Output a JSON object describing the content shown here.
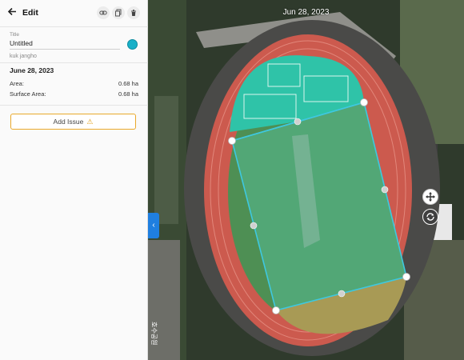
{
  "header": {
    "title": "Edit",
    "back_icon": "arrow-left-icon",
    "actions": [
      "link-icon",
      "copy-icon",
      "trash-icon"
    ]
  },
  "form": {
    "title_label": "Title",
    "title_value": "Untitled",
    "color": "#18b0c8",
    "author": "kuk jangho",
    "date": "June 28, 2023",
    "stats": [
      {
        "label": "Area:",
        "value": "0.68 ha"
      },
      {
        "label": "Surface Area:",
        "value": "0.68 ha"
      }
    ],
    "add_issue_label": "Add Issue",
    "add_issue_icon": "warning-icon"
  },
  "map": {
    "date": "Jun 28, 2023",
    "side_label": "호수공원",
    "controls": [
      "move-icon",
      "rotate-icon"
    ],
    "polygon_color": "#3ec8e0",
    "accent": "#1f7fe0"
  }
}
